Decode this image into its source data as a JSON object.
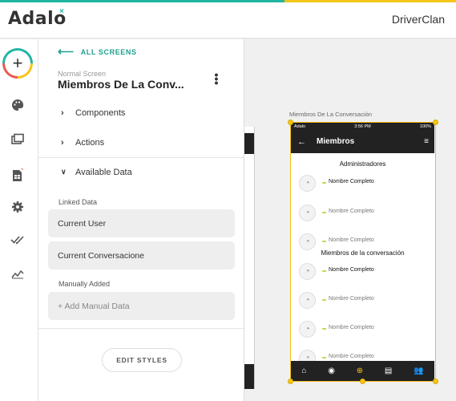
{
  "header": {
    "logo_text": "Adalo",
    "app_name": "DriverClan"
  },
  "leftnav": {
    "items": [
      {
        "name": "add",
        "icon": "plus-icon"
      },
      {
        "name": "branding",
        "icon": "palette-icon"
      },
      {
        "name": "screens",
        "icon": "screens-icon"
      },
      {
        "name": "database",
        "icon": "database-icon"
      },
      {
        "name": "settings",
        "icon": "gear-icon"
      },
      {
        "name": "publish",
        "icon": "double-check-icon"
      },
      {
        "name": "analytics",
        "icon": "chart-icon"
      }
    ]
  },
  "panel": {
    "back_label": "ALL SCREENS",
    "screen_type": "Normal Screen",
    "screen_name": "Miembros De La Conv...",
    "sections": [
      {
        "label": "Components",
        "expanded": false
      },
      {
        "label": "Actions",
        "expanded": false
      },
      {
        "label": "Available Data",
        "expanded": true
      }
    ],
    "linked_data_label": "Linked Data",
    "linked_data": [
      "Current User",
      "Current Conversacione"
    ],
    "manual_label": "Manually Added",
    "manual_placeholder": "+ Add Manual Data",
    "edit_styles_label": "EDIT STYLES"
  },
  "canvas": {
    "frame_label": "Miembros De La Conversación",
    "statusbar": {
      "carrier": "Adalo",
      "time": "3:56 PM",
      "battery": "100%"
    },
    "appbar_title": "Miembros",
    "sections": [
      "Administradores",
      "Miembros de la conversación"
    ],
    "member_name": "Nombre Completo"
  },
  "colors": {
    "accent": "#21b5a4",
    "highlight": "#f5c518",
    "dark": "#222222"
  }
}
